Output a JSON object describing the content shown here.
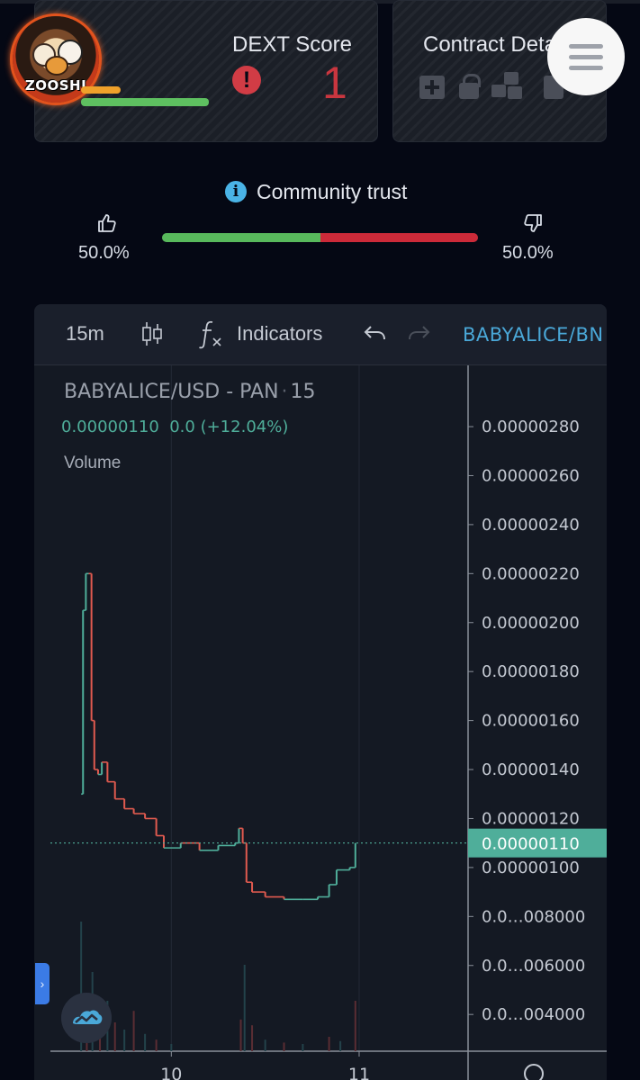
{
  "header": {
    "logo_text": "ZOOSHI",
    "score": {
      "title": "DEXT Score",
      "value": "1",
      "alert_icon": "exclamation-circle-icon"
    },
    "contract": {
      "title": "Contract Deta",
      "icons": [
        "plus-square-icon",
        "lock-icon",
        "cubes-icon",
        "mail-icon"
      ]
    },
    "menu_icon": "hamburger-menu-icon"
  },
  "trust": {
    "title": "Community trust",
    "info_icon": "info-circle-icon",
    "up_percent": "50.0%",
    "down_percent": "50.0%",
    "up_fraction": 0.5,
    "colors": {
      "up": "#58b95c",
      "down": "#cc2a39"
    }
  },
  "toolbar": {
    "interval": "15m",
    "indicators": "Indicators",
    "symbol": "BABYALICE/BN"
  },
  "legend": {
    "pair": "BABYALICE/USD - PAN",
    "interval": "15",
    "values": "0.00000110  0.0 (+12.04%)",
    "volume_label": "Volume"
  },
  "chart_data": {
    "type": "candlestick",
    "y_tick_labels": [
      "0.00000280",
      "0.00000260",
      "0.00000240",
      "0.00000220",
      "0.00000200",
      "0.00000180",
      "0.00000160",
      "0.00000140",
      "0.00000120",
      "0.00000100",
      "0.0…008000",
      "0.0…006000",
      "0.0…004000"
    ],
    "y_ticks": [
      2.8e-06,
      2.6e-06,
      2.4e-06,
      2.2e-06,
      2e-06,
      1.8e-06,
      1.6e-06,
      1.4e-06,
      1.2e-06,
      1e-06,
      8e-07,
      6e-07,
      4e-07
    ],
    "ylim": [
      2.5e-07,
      3.05e-06
    ],
    "x_tick_labels": [
      "10",
      "11"
    ],
    "x_ticks": [
      10,
      11
    ],
    "xlim": [
      9.27,
      11.58
    ],
    "current_price_label": "0.00000110",
    "current_price": 1.1e-06,
    "colors": {
      "up": "#4fae9a",
      "down": "#e05a4f",
      "current_price": "#4fae9a"
    },
    "series": [
      {
        "name": "price",
        "points": [
          [
            9.52,
            1.3e-06
          ],
          [
            9.53,
            2.05e-06
          ],
          [
            9.545,
            2.2e-06
          ],
          [
            9.56,
            2.2e-06
          ],
          [
            9.575,
            1.6e-06
          ],
          [
            9.59,
            1.4e-06
          ],
          [
            9.61,
            1.38e-06
          ],
          [
            9.63,
            1.43e-06
          ],
          [
            9.66,
            1.35e-06
          ],
          [
            9.7,
            1.28e-06
          ],
          [
            9.75,
            1.24e-06
          ],
          [
            9.8,
            1.22e-06
          ],
          [
            9.86,
            1.2e-06
          ],
          [
            9.92,
            1.13e-06
          ],
          [
            9.96,
            1.08e-06
          ],
          [
            10.05,
            1.1e-06
          ],
          [
            10.15,
            1.07e-06
          ],
          [
            10.25,
            1.09e-06
          ],
          [
            10.34,
            1.1e-06
          ],
          [
            10.36,
            1.16e-06
          ],
          [
            10.38,
            1.1e-06
          ],
          [
            10.4,
            9.4e-07
          ],
          [
            10.43,
            9e-07
          ],
          [
            10.5,
            8.8e-07
          ],
          [
            10.6,
            8.7e-07
          ],
          [
            10.7,
            8.7e-07
          ],
          [
            10.78,
            8.8e-07
          ],
          [
            10.84,
            9.3e-07
          ],
          [
            10.88,
            9.9e-07
          ],
          [
            10.95,
            1e-06
          ],
          [
            10.98,
            1.1e-06
          ]
        ]
      }
    ],
    "volume": [
      [
        9.52,
        0.9
      ],
      [
        9.55,
        0.4
      ],
      [
        9.58,
        0.55
      ],
      [
        9.62,
        0.3
      ],
      [
        9.66,
        0.35
      ],
      [
        9.7,
        0.2
      ],
      [
        9.75,
        0.15
      ],
      [
        9.8,
        0.28
      ],
      [
        9.86,
        0.12
      ],
      [
        9.92,
        0.08
      ],
      [
        10.0,
        0.05
      ],
      [
        10.37,
        0.22
      ],
      [
        10.39,
        0.6
      ],
      [
        10.43,
        0.18
      ],
      [
        10.5,
        0.08
      ],
      [
        10.6,
        0.06
      ],
      [
        10.7,
        0.05
      ],
      [
        10.84,
        0.1
      ],
      [
        10.9,
        0.07
      ],
      [
        10.98,
        0.35
      ]
    ]
  }
}
